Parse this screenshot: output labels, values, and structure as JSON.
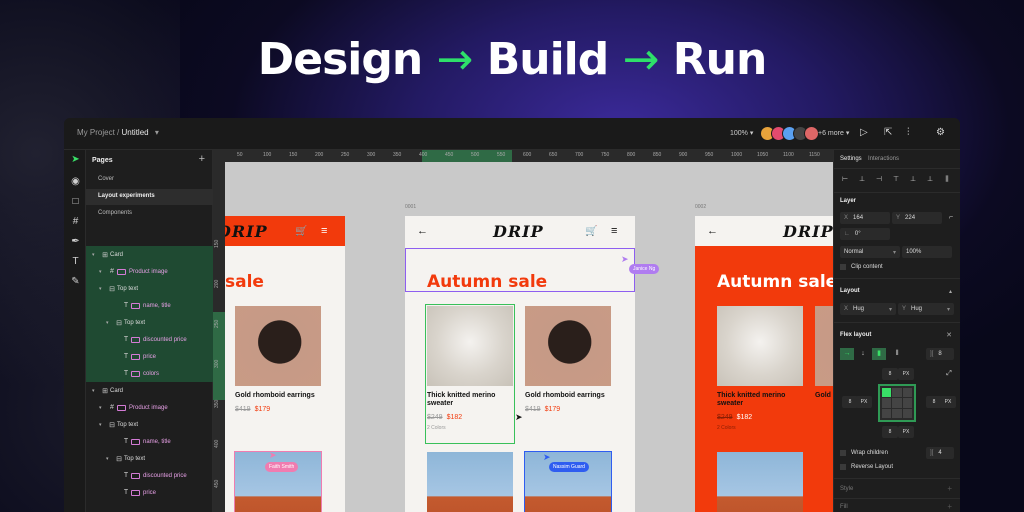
{
  "hero": {
    "word1": "Design",
    "word2": "Build",
    "word3": "Run",
    "arrow": "→"
  },
  "topbar": {
    "project": "My Project",
    "separator": " / ",
    "file": "Untitled",
    "caret": "▾",
    "zoom": "100% ▾",
    "more": "+6 more ▾",
    "avatar_colors": [
      "#e8a33b",
      "#e24b6e",
      "#5aa0f0",
      "#444",
      "#d66"
    ]
  },
  "toolbar": {
    "icons": [
      "pointer-icon",
      "eye-icon",
      "frame-icon",
      "grid-icon",
      "pen-icon",
      "text-icon",
      "eyedropper-icon"
    ]
  },
  "layers": {
    "pages_title": "Pages",
    "add": "+",
    "pages": [
      "Cover",
      "Layout experiments",
      "Components"
    ],
    "tree": [
      {
        "label": "Card",
        "indent": 0,
        "icon": "⊞",
        "hl": true
      },
      {
        "label": "Product image",
        "indent": 1,
        "icon": "#",
        "hl": true,
        "tag": true
      },
      {
        "label": "Top text",
        "indent": 1,
        "icon": "⊟",
        "hl": true
      },
      {
        "label": "name, title",
        "indent": 3,
        "icon": "T",
        "hl": true,
        "tag": true
      },
      {
        "label": "Top text",
        "indent": 2,
        "icon": "⊟",
        "hl": true
      },
      {
        "label": "discounted price",
        "indent": 3,
        "icon": "T",
        "hl": true,
        "tag": true
      },
      {
        "label": "price",
        "indent": 3,
        "icon": "T",
        "hl": true,
        "tag": true
      },
      {
        "label": "colors",
        "indent": 3,
        "icon": "T",
        "hl": true,
        "tag": true
      },
      {
        "label": "Card",
        "indent": 0,
        "icon": "⊞",
        "hl": false
      },
      {
        "label": "Product image",
        "indent": 1,
        "icon": "#",
        "hl": false,
        "tag": true
      },
      {
        "label": "Top text",
        "indent": 1,
        "icon": "⊟",
        "hl": false
      },
      {
        "label": "name, title",
        "indent": 3,
        "icon": "T",
        "hl": false,
        "tag": true
      },
      {
        "label": "Top text",
        "indent": 2,
        "icon": "⊟",
        "hl": false
      },
      {
        "label": "discounted price",
        "indent": 3,
        "icon": "T",
        "hl": false,
        "tag": true
      },
      {
        "label": "price",
        "indent": 3,
        "icon": "T",
        "hl": false,
        "tag": true
      }
    ]
  },
  "ruler": {
    "h": [
      "50",
      "100",
      "150",
      "200",
      "250",
      "300",
      "350",
      "400",
      "450",
      "500",
      "550",
      "600",
      "650",
      "700",
      "750",
      "800",
      "850",
      "900",
      "950",
      "1000",
      "1050",
      "1100",
      "1150"
    ],
    "v": [
      "150",
      "200",
      "250",
      "300",
      "350",
      "400",
      "450"
    ]
  },
  "frames": {
    "label_mid": "0001",
    "label_right": "0002"
  },
  "store": {
    "logo": "DRIP",
    "headline": "Autumn sale",
    "headline_cut": "sale",
    "product1": {
      "name": "Thick knitted merino sweater",
      "price": "$249",
      "discounted": "$182",
      "colors": "2 Colors"
    },
    "product2": {
      "name": "Gold rhomboid earrings",
      "price": "$419",
      "discounted": "$179"
    },
    "product2_cut": "Gold",
    "logo_cut": "DRIP"
  },
  "collaborators": {
    "janice": {
      "name": "Janice Ng",
      "color": "#b07cf0"
    },
    "faith": {
      "name": "Faith Smith",
      "color": "#f07cb0"
    },
    "nassim": {
      "name": "Nassim Guard",
      "color": "#2f5df0"
    }
  },
  "props": {
    "tabs": [
      "Settings",
      "Interactions"
    ],
    "layer_title": "Layer",
    "x": "164",
    "y": "224",
    "rotation": "0°",
    "blend": "Normal",
    "opacity": "100%",
    "clip": "Clip content",
    "layout_title": "Layout",
    "w": "Hug",
    "h": "Hug",
    "flex_title": "Flex layout",
    "gap": "8",
    "pad_top": "8",
    "pad_left": "8",
    "pad_right": "8",
    "pad_bottom": "8",
    "px": "PX",
    "wrap": "Wrap children",
    "wrap_gap": "4",
    "reverse": "Reverse Layout",
    "style_title": "Style",
    "fill_title": "Fill",
    "axis_x": "X",
    "axis_y": "Y",
    "toggle": "▾",
    "plus": "+",
    "close": "✕",
    "expand": "⤢"
  }
}
